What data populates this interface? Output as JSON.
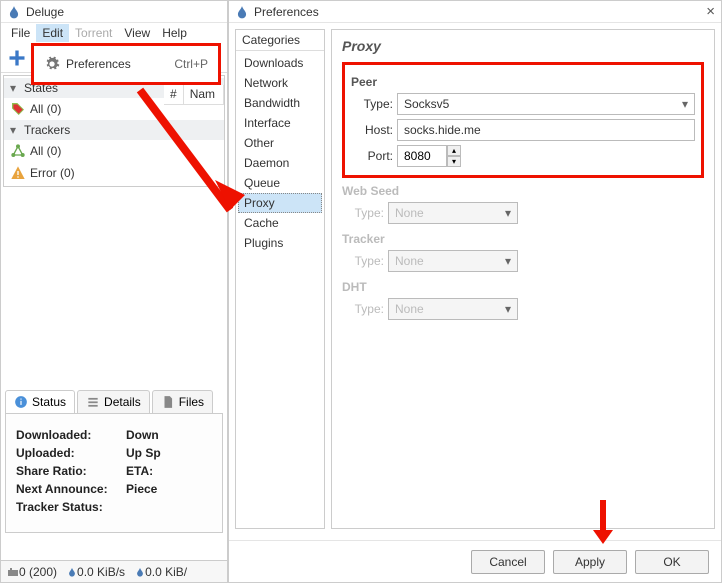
{
  "app": {
    "title": "Deluge"
  },
  "menubar": {
    "file": "File",
    "edit": "Edit",
    "torrent": "Torrent",
    "view": "View",
    "help": "Help"
  },
  "edit_menu": {
    "preferences": "Preferences",
    "shortcut": "Ctrl+P"
  },
  "list_header": {
    "num": "#",
    "name": "Nam"
  },
  "sidebar": {
    "states_label": "States",
    "all": "All (0)",
    "trackers_label": "Trackers",
    "trackers_all": "All (0)",
    "error": "Error (0)"
  },
  "tabs": {
    "status": "Status",
    "details": "Details",
    "files": "Files"
  },
  "status_panel": {
    "downloaded_l": "Downloaded:",
    "downloaded_v": "Down",
    "uploaded_l": "Uploaded:",
    "uploaded_v": "Up Sp",
    "share_l": "Share Ratio:",
    "share_v": "ETA:",
    "announce_l": "Next Announce:",
    "announce_v": "Piece",
    "tracker_l": "Tracker Status:"
  },
  "statusbar": {
    "conns": "0 (200)",
    "down": "0.0 KiB/s",
    "up": "0.0 KiB/"
  },
  "prefs": {
    "title": "Preferences",
    "categories_header": "Categories",
    "categories": [
      "Downloads",
      "Network",
      "Bandwidth",
      "Interface",
      "Other",
      "Daemon",
      "Queue",
      "Proxy",
      "Cache",
      "Plugins"
    ],
    "selected": "Proxy",
    "page_title": "Proxy",
    "sections": {
      "peer": "Peer",
      "webseed": "Web Seed",
      "tracker": "Tracker",
      "dht": "DHT"
    },
    "fields": {
      "type_l": "Type:",
      "host_l": "Host:",
      "port_l": "Port:",
      "type_v": "Socksv5",
      "host_v": "socks.hide.me",
      "port_v": "8080",
      "none": "None"
    },
    "buttons": {
      "cancel": "Cancel",
      "apply": "Apply",
      "ok": "OK"
    }
  }
}
